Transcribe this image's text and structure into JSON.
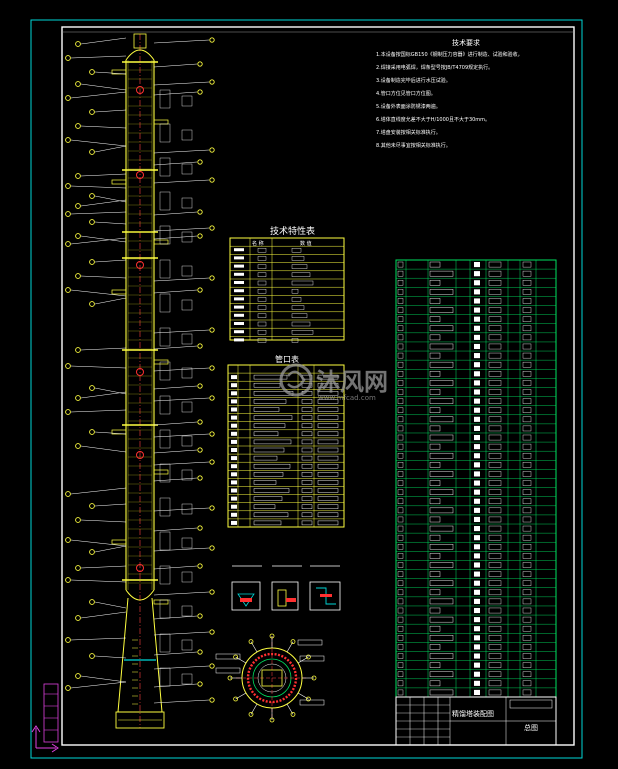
{
  "drawing": {
    "notes_title": "技术要求",
    "notes": [
      "1.本设备按国标GB150《钢制压力容器》进行制造、试验和验收，",
      "2.焊接采用电弧焊，焊条型号按JB/T4709规定执行。",
      "3.设备制造完毕后进行水压试验。",
      "4.管口方位见管口方位图。",
      "5.设备外表面涂防锈漆两遍。",
      "6.塔体直线度允差不大于H/1000且不大于30mm。",
      "7.塔盘安装按相关标准执行。",
      "8.其他未尽事宜按相关标准执行。"
    ],
    "tech_table_title": "技术特性表",
    "tech_table_header": [
      "名 称",
      "数 值"
    ],
    "nozzle_table_title": "管口表",
    "title_block_name": "精馏塔装配图",
    "title_block_sheet": "总图",
    "watermark_text": "沐风网",
    "watermark_url": "www.mfcad.com"
  },
  "colors": {
    "border": "#00d8d8",
    "frame": "#ffffff",
    "tower": "#ffff40",
    "leader": "#ffffff",
    "table_green": "#00e060",
    "hatch": "#ff3030",
    "magenta": "#e040e0"
  },
  "icons": {
    "origin": "ucs-origin-icon",
    "watermark": "mufeng-logo-icon"
  }
}
